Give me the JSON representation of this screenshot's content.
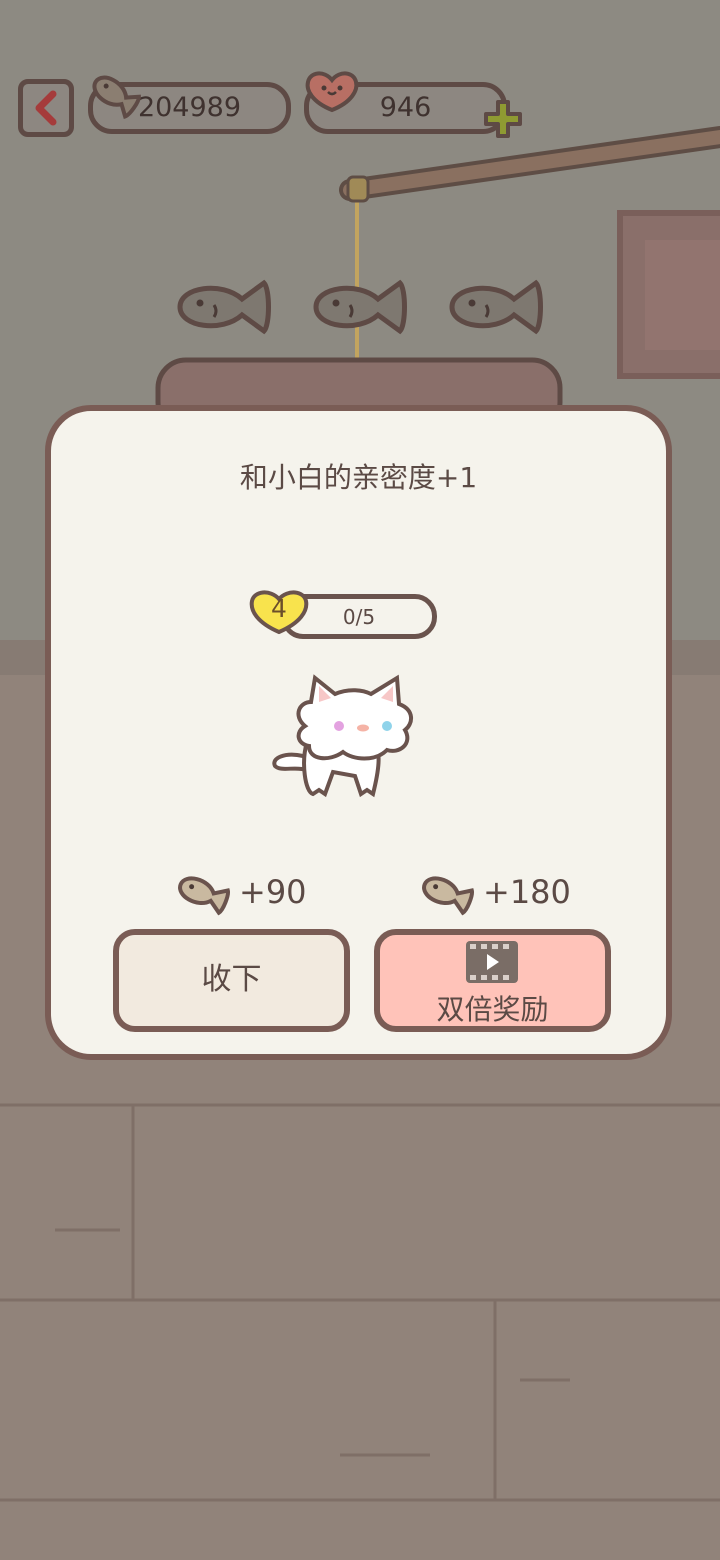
{
  "hud": {
    "fish_count": "204989",
    "heart_count": "946"
  },
  "modal": {
    "title": "和小白的亲密度+1",
    "level": "4",
    "progress_text": "0/5",
    "reward_normal": "+90",
    "reward_double": "+180",
    "collect_label": "收下",
    "double_label": "双倍奖励"
  },
  "colors": {
    "accent_pink": "#ffc3b9",
    "panel": "#f5f3ec",
    "outline": "#7a5c55",
    "heart_yellow": "#f8e34d"
  },
  "icons": [
    "back-arrow-icon",
    "fish-icon",
    "heart-icon",
    "plus-icon",
    "video-icon",
    "cat-character",
    "fish-treat-icon"
  ]
}
